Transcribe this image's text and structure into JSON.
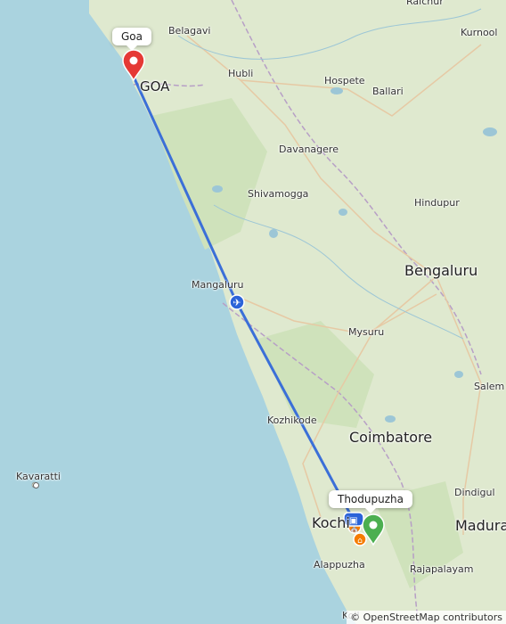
{
  "map": {
    "places": [
      {
        "id": "raichur",
        "label": "Raichur"
      },
      {
        "id": "belagavi",
        "label": "Belagavi"
      },
      {
        "id": "kurnool",
        "label": "Kurnool"
      },
      {
        "id": "hubli",
        "label": "Hubli"
      },
      {
        "id": "hospete",
        "label": "Hospete"
      },
      {
        "id": "ballari",
        "label": "Ballari"
      },
      {
        "id": "davanagere",
        "label": "Davanagere"
      },
      {
        "id": "shivamogga",
        "label": "Shivamogga"
      },
      {
        "id": "hindupur",
        "label": "Hindupur"
      },
      {
        "id": "bengaluru",
        "label": "Bengaluru"
      },
      {
        "id": "mangaluru",
        "label": "Mangaluru"
      },
      {
        "id": "mysuru",
        "label": "Mysuru"
      },
      {
        "id": "salem",
        "label": "Salem"
      },
      {
        "id": "kozhikode",
        "label": "Kozhikode"
      },
      {
        "id": "coimbatore",
        "label": "Coimbatore"
      },
      {
        "id": "kavaratti",
        "label": "Kavaratti"
      },
      {
        "id": "dindigul",
        "label": "Dindigul"
      },
      {
        "id": "kochi",
        "label": "Kochi"
      },
      {
        "id": "madurai",
        "label": "Madurai"
      },
      {
        "id": "alappuzha",
        "label": "Alappuzha"
      },
      {
        "id": "rajapalayam",
        "label": "Rajapalayam"
      },
      {
        "id": "kollam",
        "label": "Koll"
      }
    ],
    "state_label": "GOA",
    "origin_callout": "Goa",
    "destination_callout": "Thodupuzha",
    "attribution_symbol": "©",
    "attribution_text": "OpenStreetMap contributors",
    "colors": {
      "sea": "#aad3df",
      "land": "#d8e8c8",
      "route": "#3b6fd8",
      "origin_marker": "#e53935",
      "destination_marker": "#4caf50",
      "poi_marker": "#f57c00",
      "transport_marker": "#2b63d9"
    }
  }
}
